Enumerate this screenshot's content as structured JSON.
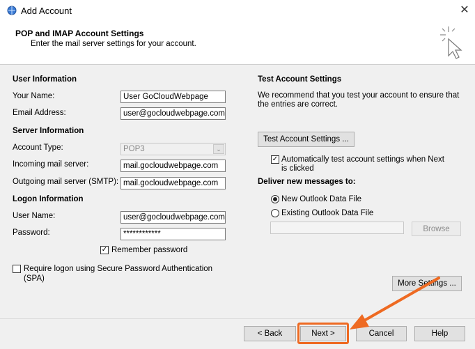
{
  "window": {
    "title": "Add Account",
    "close": "✕"
  },
  "header": {
    "title": "POP and IMAP Account Settings",
    "subtitle": "Enter the mail server settings for your account."
  },
  "user_info": {
    "heading": "User Information",
    "your_name_label": "Your Name:",
    "your_name_value": "User GoCloudWebpage",
    "email_label": "Email Address:",
    "email_value": "user@gocloudwebpage.com"
  },
  "server_info": {
    "heading": "Server Information",
    "account_type_label": "Account Type:",
    "account_type_value": "POP3",
    "incoming_label": "Incoming mail server:",
    "incoming_value": "mail.gocloudwebpage.com",
    "outgoing_label": "Outgoing mail server (SMTP):",
    "outgoing_value": "mail.gocloudwebpage.com"
  },
  "logon_info": {
    "heading": "Logon Information",
    "user_name_label": "User Name:",
    "user_name_value": "user@gocloudwebpage.com",
    "password_label": "Password:",
    "password_value": "************",
    "remember_label": "Remember password",
    "remember_checked": true,
    "spa_label_1": "Require logon using Secure Password Authentication",
    "spa_label_2": "(SPA)",
    "spa_checked": false
  },
  "test_settings": {
    "heading": "Test Account Settings",
    "desc_1": "We recommend that you test your account to ensure that",
    "desc_2": "the entries are correct.",
    "test_button": "Test Account Settings ...",
    "auto_label_1": "Automatically test account settings when Next",
    "auto_label_2": "is clicked",
    "auto_checked": true
  },
  "deliver": {
    "heading": "Deliver new messages to:",
    "new_file_label": "New Outlook Data File",
    "existing_file_label": "Existing Outlook Data File",
    "browse_button": "Browse",
    "selected": "new"
  },
  "buttons": {
    "more_settings": "More Settings ...",
    "back": "< Back",
    "next": "Next >",
    "cancel": "Cancel",
    "help": "Help"
  },
  "annotation_color": "#ee6a22"
}
